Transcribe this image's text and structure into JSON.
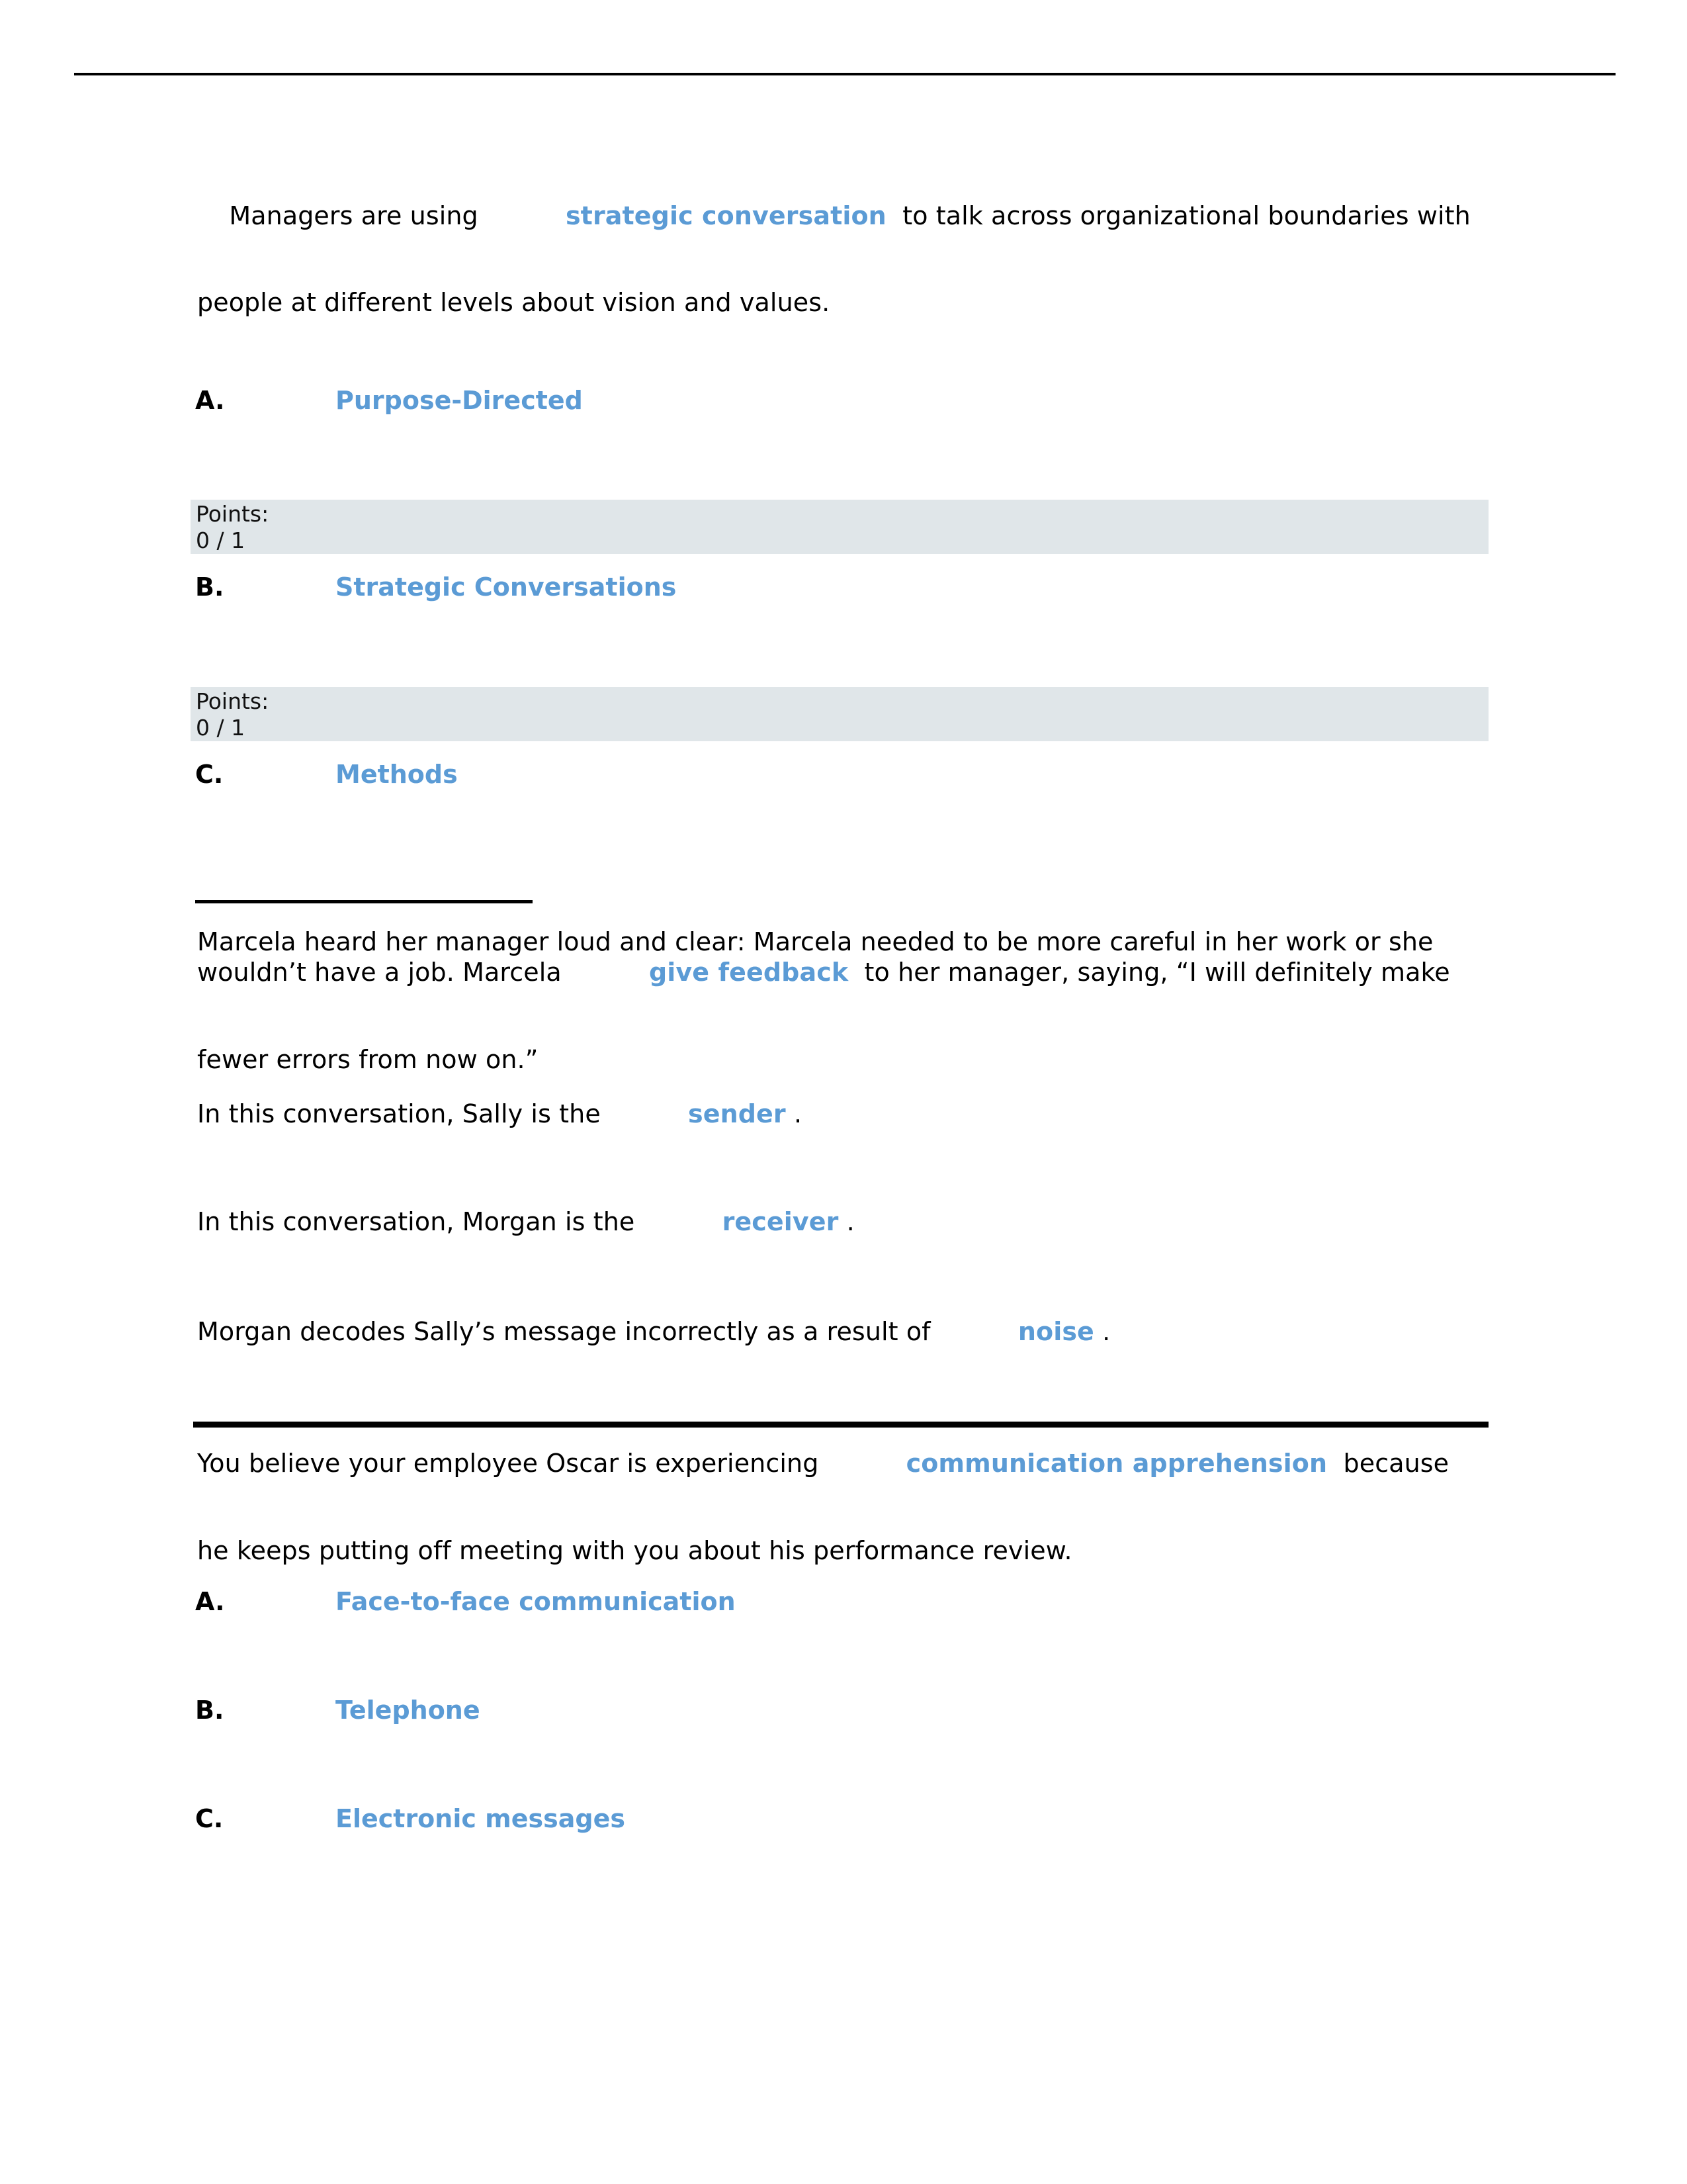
{
  "document": {
    "colors": {
      "answer_blue": "#5b9bd5",
      "points_band_background": "#e0e6e9",
      "rule_black": "#000000",
      "page_background": "#ffffff"
    }
  },
  "question1": {
    "stem_line1_before": "  Managers are using ",
    "stem_line1_answer": "strategic conversation",
    "stem_line1_after": "  to talk across organizational boundaries with",
    "stem_line2": "people at different levels about vision and values.",
    "options": [
      {
        "letter": "A.",
        "label": "Purpose-Directed"
      },
      {
        "letter": "B.",
        "label": "Strategic Conversations"
      },
      {
        "letter": "C.",
        "label": "Methods"
      }
    ],
    "points_blocks": [
      {
        "title": "Points:",
        "value": "0 / 1"
      },
      {
        "title": "Points:",
        "value": "0 / 1"
      }
    ]
  },
  "question2": {
    "scenario_line1": "Marcela heard her manager loud and clear: Marcela needed to be more careful in her work or she",
    "scenario_line2_before": "wouldn’t have a job. Marcela ",
    "scenario_line2_answer": "give feedback",
    "scenario_line2_after": "  to her manager, saying, “I will definitely make",
    "scenario_line3": "fewer errors from now on.”",
    "statements": [
      {
        "before": "In this conversation, Sally is the ",
        "answer": "sender",
        "after": " ."
      },
      {
        "before": "In this conversation, Morgan is the ",
        "answer": "receiver",
        "after": " ."
      },
      {
        "before": "Morgan decodes Sally’s message incorrectly as a result of ",
        "answer": "noise",
        "after": " ."
      }
    ]
  },
  "question3": {
    "stem_line1_before": "You believe your employee Oscar is experiencing ",
    "stem_line1_answer": "communication apprehension",
    "stem_line1_after": "  because",
    "stem_line2": "he keeps putting off meeting with you about his performance review.",
    "options": [
      {
        "letter": "A.",
        "label": "Face-to-face communication"
      },
      {
        "letter": "B.",
        "label": "Telephone"
      },
      {
        "letter": "C.",
        "label": "Electronic messages"
      }
    ]
  }
}
